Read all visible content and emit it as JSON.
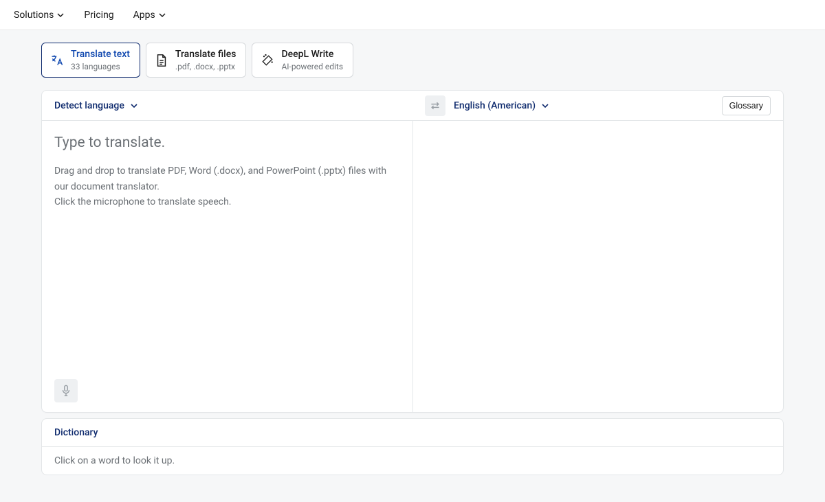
{
  "nav": {
    "solutions": "Solutions",
    "pricing": "Pricing",
    "apps": "Apps"
  },
  "modeTabs": {
    "translateText": {
      "label": "Translate text",
      "sub": "33 languages"
    },
    "translateFiles": {
      "label": "Translate files",
      "sub": ".pdf, .docx, .pptx"
    },
    "deeplWrite": {
      "label": "DeepL Write",
      "sub": "AI-powered edits"
    }
  },
  "langBar": {
    "sourceLabel": "Detect language",
    "targetLabel": "English (American)",
    "glossary": "Glossary"
  },
  "sourcePane": {
    "placeholder": "Type to translate.",
    "hint1": "Drag and drop to translate PDF, Word (.docx), and PowerPoint (.pptx) files with our document translator.",
    "hint2": "Click the microphone to translate speech."
  },
  "dictionary": {
    "title": "Dictionary",
    "hint": "Click on a word to look it up."
  }
}
